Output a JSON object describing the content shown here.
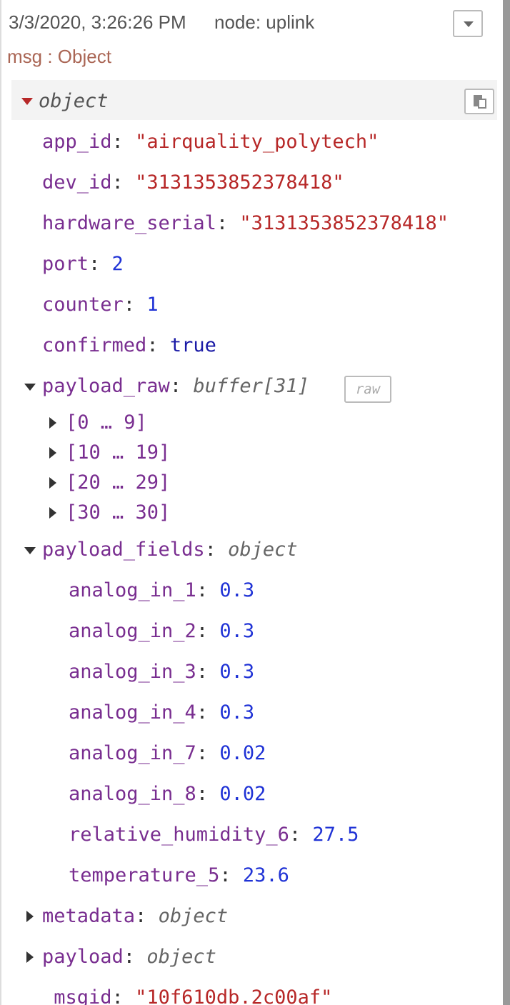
{
  "header": {
    "timestamp": "3/3/2020, 3:26:26 PM",
    "node_label": "node: uplink",
    "msg_label": "msg : Object"
  },
  "root": {
    "type_label": "object"
  },
  "fields": {
    "app_id": {
      "key": "app_id",
      "value": "\"airquality_polytech\""
    },
    "dev_id": {
      "key": "dev_id",
      "value": "\"3131353852378418\""
    },
    "hardware_serial": {
      "key": "hardware_serial",
      "value": "\"3131353852378418\""
    },
    "port": {
      "key": "port",
      "value": "2"
    },
    "counter": {
      "key": "counter",
      "value": "1"
    },
    "confirmed": {
      "key": "confirmed",
      "value": "true"
    },
    "payload_raw": {
      "key": "payload_raw",
      "type_label": "buffer[31]",
      "raw_button": "raw"
    },
    "payload_raw_ranges": [
      "[0 … 9]",
      "[10 … 19]",
      "[20 … 29]",
      "[30 … 30]"
    ],
    "payload_fields": {
      "key": "payload_fields",
      "type_label": "object"
    },
    "payload_fields_items": [
      {
        "key": "analog_in_1",
        "value": "0.3"
      },
      {
        "key": "analog_in_2",
        "value": "0.3"
      },
      {
        "key": "analog_in_3",
        "value": "0.3"
      },
      {
        "key": "analog_in_4",
        "value": "0.3"
      },
      {
        "key": "analog_in_7",
        "value": "0.02"
      },
      {
        "key": "analog_in_8",
        "value": "0.02"
      },
      {
        "key": "relative_humidity_6",
        "value": "27.5"
      },
      {
        "key": "temperature_5",
        "value": "23.6"
      }
    ],
    "metadata": {
      "key": "metadata",
      "type_label": "object"
    },
    "payload": {
      "key": "payload",
      "type_label": "object"
    },
    "msgid": {
      "key": "_msgid",
      "value": "\"10f610db.2c00af\""
    }
  },
  "colors": {
    "key": "#792e90",
    "string": "#b72828",
    "number": "#2033d6",
    "bool": "#1a1aa6",
    "msg_label": "#aa6655"
  },
  "icons": {
    "menu": "chevron-down-icon",
    "copy": "copy-icon",
    "expand": "triangle-down-icon",
    "collapse": "triangle-right-icon"
  }
}
